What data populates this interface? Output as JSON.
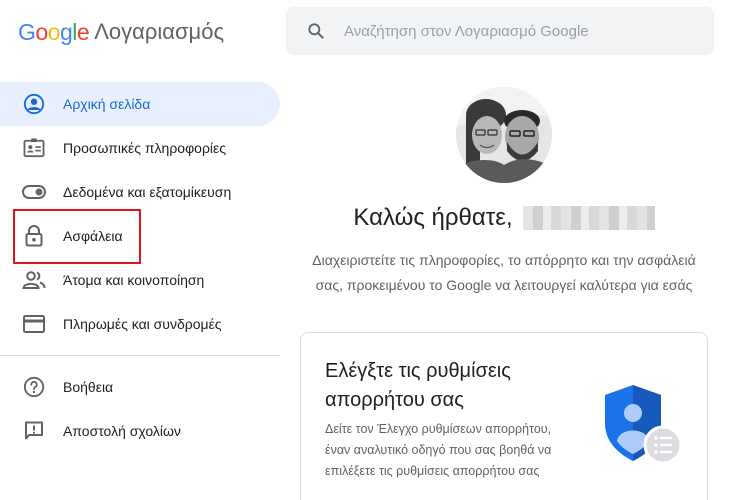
{
  "header": {
    "logo_text": "Google",
    "product_name": "Λογαριασμός",
    "search_placeholder": "Αναζήτηση στον Λογαριασμό Google"
  },
  "nav": {
    "items": [
      {
        "label": "Αρχική σελίδα",
        "icon": "account-circle-icon",
        "active": true
      },
      {
        "label": "Προσωπικές πληροφορίες",
        "icon": "id-card-icon",
        "active": false
      },
      {
        "label": "Δεδομένα και εξατομίκευση",
        "icon": "toggle-icon",
        "active": false
      },
      {
        "label": "Ασφάλεια",
        "icon": "lock-icon",
        "active": false
      },
      {
        "label": "Άτομα και κοινοποίηση",
        "icon": "people-icon",
        "active": false
      },
      {
        "label": "Πληρωμές και συνδρομές",
        "icon": "credit-card-icon",
        "active": false
      }
    ],
    "secondary": [
      {
        "label": "Βοήθεια",
        "icon": "help-icon"
      },
      {
        "label": "Αποστολή σχολίων",
        "icon": "feedback-icon"
      }
    ]
  },
  "main": {
    "welcome": "Καλώς ήρθατε,",
    "subtitle": "Διαχειριστείτε τις πληροφορίες, το απόρρητο και την ασφάλειά σας, προκειμένου το Google να λειτουργεί καλύτερα για εσάς",
    "card": {
      "title": "Ελέγξτε τις ρυθμίσεις απορρήτου σας",
      "text": "Δείτε τον Έλεγχο ρυθμίσεων απορρήτου, έναν αναλυτικό οδηγό που σας βοηθά να επιλέξετε τις ρυθμίσεις απορρήτου σας"
    }
  },
  "colors": {
    "accent": "#1a73e8",
    "active_bg": "#e8f0fe",
    "highlight": "#e0121b"
  }
}
